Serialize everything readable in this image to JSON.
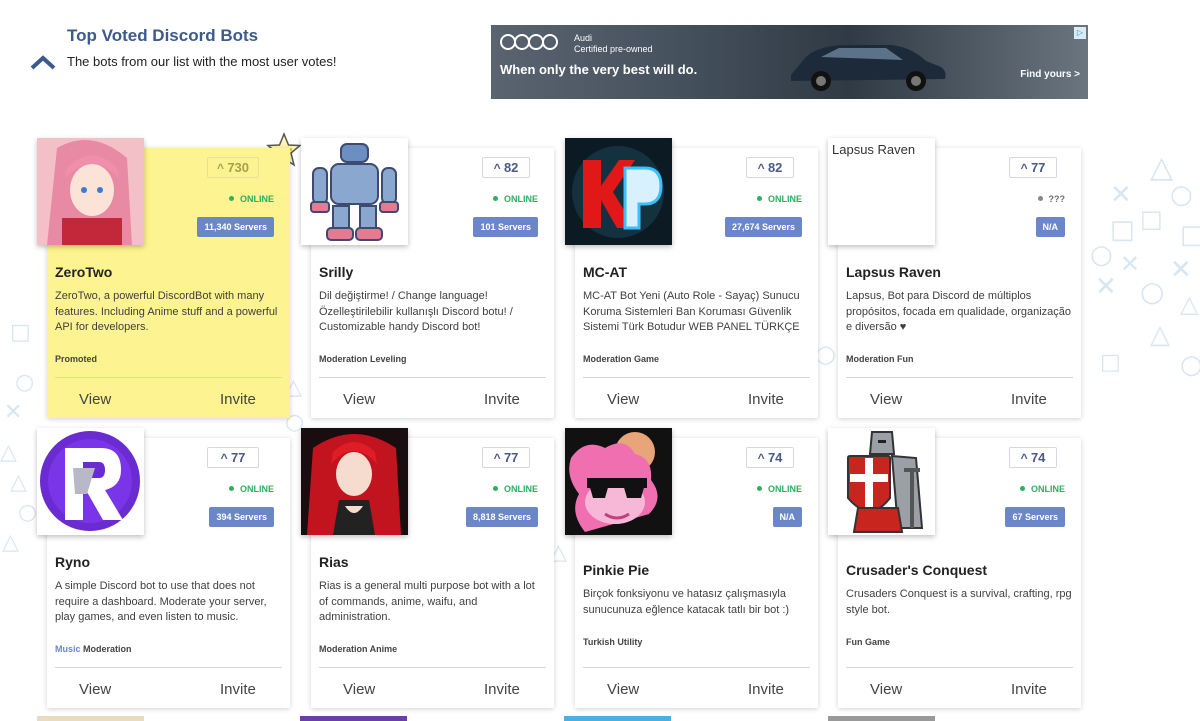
{
  "header": {
    "title": "Top Voted Discord Bots",
    "subtitle": "The bots from our list with the most user votes!"
  },
  "ad": {
    "brand": "Audi",
    "sub": "Certified pre-owned",
    "tagline": "When only the very best will do.",
    "cta": "Find yours >",
    "adchoices": "▷"
  },
  "actions": {
    "view": "View",
    "invite": "Invite"
  },
  "bots": [
    {
      "name": "ZeroTwo",
      "votes": "730",
      "status": "ONLINE",
      "servers": "11,340 Servers",
      "description": "ZeroTwo, a powerful DiscordBot with many features. Including Anime stuff and a powerful API for developers.",
      "tags": "Promoted",
      "tag_highlight": "",
      "promoted": true,
      "avatar_icon": "anime-girl-avatar"
    },
    {
      "name": "Srilly",
      "votes": "82",
      "status": "ONLINE",
      "servers": "101 Servers",
      "description": "Dil değiştirme! / Change language! Özelleştirilebilir kullanışlı Discord botu! / Customizable handy Discord bot!",
      "tags": "Moderation Leveling",
      "tag_highlight": "",
      "promoted": false,
      "avatar_icon": "robot-avatar"
    },
    {
      "name": "MC-AT",
      "votes": "82",
      "status": "ONLINE",
      "servers": "27,674 Servers",
      "description": "MC-AT Bot Yeni (Auto Role - Sayaç) Sunucu Koruma Sistemleri Ban Koruması Güvenlik Sistemi Türk Botudur WEB PANEL TÜRKÇE",
      "tags": "Moderation Game",
      "tag_highlight": "",
      "promoted": false,
      "avatar_icon": "kp-logo-avatar"
    },
    {
      "name": "Lapsus Raven",
      "votes": "77",
      "status": "???",
      "servers": "N/A",
      "description": "Lapsus, Bot para Discord de múltiplos propósitos, focada em qualidade, organização e diversão ♥",
      "tags": "Moderation Fun",
      "tag_highlight": "",
      "promoted": false,
      "avatar_icon": "broken-image",
      "avatar_alt": "Lapsus Raven"
    },
    {
      "name": "Ryno",
      "votes": "77",
      "status": "ONLINE",
      "servers": "394 Servers",
      "description": "A simple Discord bot to use that does not require a dashboard. Moderate your server, play games, and even listen to music.",
      "tags": "Moderation",
      "tag_highlight": "Music",
      "promoted": false,
      "avatar_icon": "r-logo-avatar"
    },
    {
      "name": "Rias",
      "votes": "77",
      "status": "ONLINE",
      "servers": "8,818 Servers",
      "description": "Rias is a general multi purpose bot with a lot of commands, anime, waifu, and administration.",
      "tags": "Moderation Anime",
      "tag_highlight": "",
      "promoted": false,
      "avatar_icon": "red-hair-anime-avatar"
    },
    {
      "name": "Pinkie Pie",
      "votes": "74",
      "status": "ONLINE",
      "servers": "N/A",
      "description": "Birçok fonksiyonu ve hatasız çalışmasıyla sunucunuza eğlence katacak tatlı bir bot :)",
      "tags": "Turkish Utility",
      "tag_highlight": "",
      "promoted": false,
      "avatar_icon": "pink-pony-avatar"
    },
    {
      "name": "Crusader's Conquest",
      "votes": "74",
      "status": "ONLINE",
      "servers": "67 Servers",
      "description": "Crusaders Conquest is a survival, crafting, rpg style bot.",
      "tags": "Fun Game",
      "tag_highlight": "",
      "promoted": false,
      "avatar_icon": "crusader-knight-avatar"
    }
  ]
}
